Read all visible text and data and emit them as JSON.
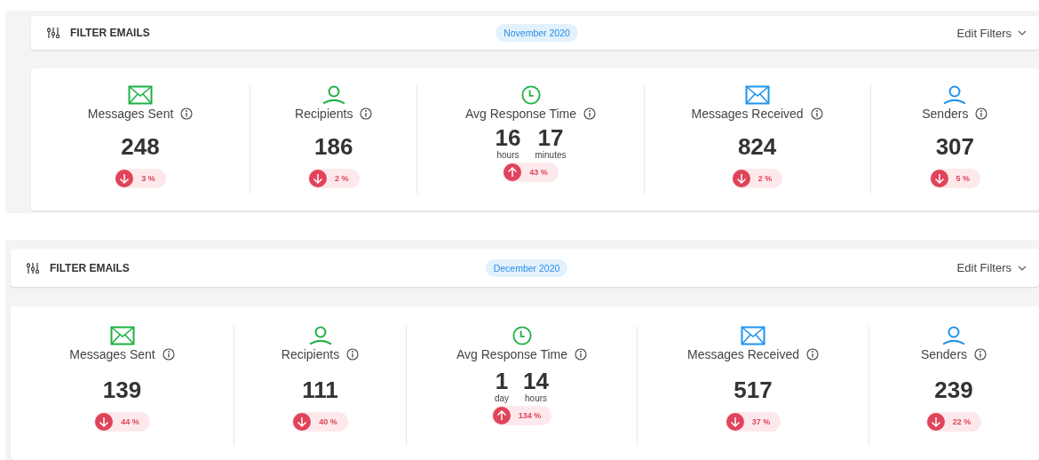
{
  "panels": [
    {
      "filter_bar": {
        "title": "FILTER EMAILS",
        "period": "November 2020",
        "action": "Edit Filters"
      },
      "stats": [
        {
          "color": "#1db144",
          "label": "Messages Sent",
          "kind": "count",
          "value": "248",
          "trend": {
            "kind": "down",
            "text": "3 %"
          }
        },
        {
          "color": "#1db144",
          "label": "Recipients",
          "kind": "count",
          "value": "186",
          "trend": {
            "kind": "down",
            "text": "2 %"
          }
        },
        {
          "color": "#1db144",
          "label": "Avg Response Time",
          "kind": "duration",
          "parts": [
            {
              "number": "16",
              "unit": "hours"
            },
            {
              "number": "17",
              "unit": "minutes"
            }
          ],
          "trend": {
            "kind": "up",
            "text": "43 %"
          }
        },
        {
          "color": "#1f93ee",
          "label": "Messages Received",
          "kind": "count",
          "value": "824",
          "trend": {
            "kind": "down",
            "text": "2 %"
          }
        },
        {
          "color": "#1f93ee",
          "label": "Senders",
          "kind": "count",
          "value": "307",
          "trend": {
            "kind": "down",
            "text": "5 %"
          }
        }
      ]
    },
    {
      "filter_bar": {
        "title": "FILTER EMAILS",
        "period": "December 2020",
        "action": "Edit Filters"
      },
      "stats": [
        {
          "color": "#1db144",
          "label": "Messages Sent",
          "kind": "count",
          "value": "139",
          "trend": {
            "kind": "down",
            "text": "44 %"
          }
        },
        {
          "color": "#1db144",
          "label": "Recipients",
          "kind": "count",
          "value": "111",
          "trend": {
            "kind": "down",
            "text": "40 %"
          }
        },
        {
          "color": "#1db144",
          "label": "Avg Response Time",
          "kind": "duration",
          "parts": [
            {
              "number": "1",
              "unit": "day"
            },
            {
              "number": "14",
              "unit": "hours"
            }
          ],
          "trend": {
            "kind": "up",
            "text": "134 %"
          }
        },
        {
          "color": "#1f93ee",
          "label": "Messages Received",
          "kind": "count",
          "value": "517",
          "trend": {
            "kind": "down",
            "text": "37 %"
          }
        },
        {
          "color": "#1f93ee",
          "label": "Senders",
          "kind": "count",
          "value": "239",
          "trend": {
            "kind": "down",
            "text": "22 %"
          }
        }
      ]
    }
  ]
}
